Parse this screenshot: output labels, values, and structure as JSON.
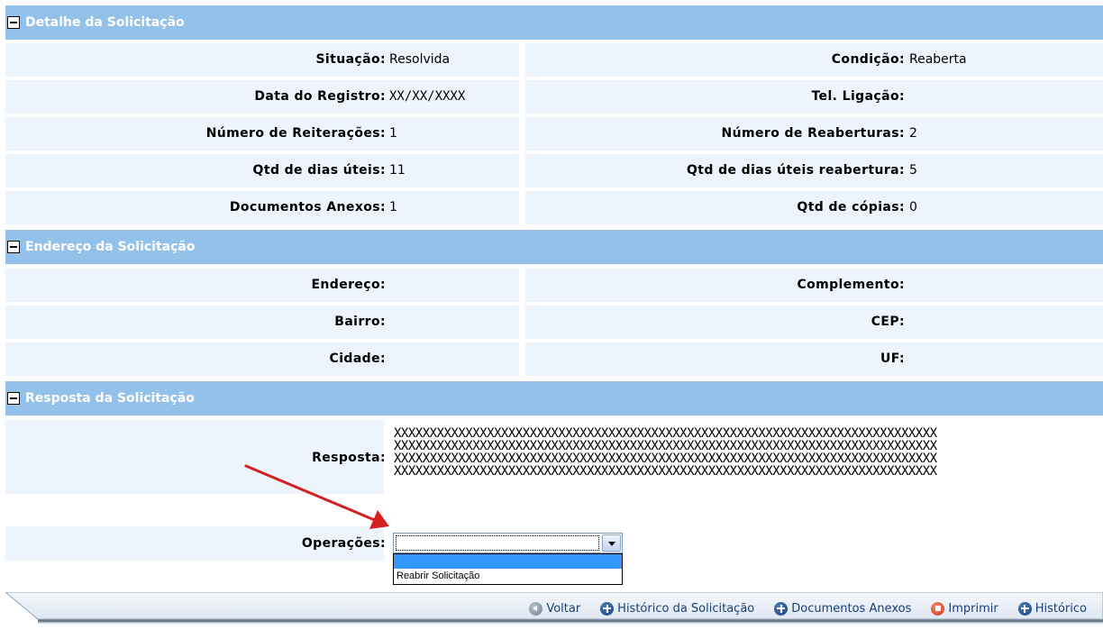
{
  "detalhe": {
    "title": "Detalhe da Solicitação",
    "situacao_label": "Situação:",
    "situacao_value": "Resolvida",
    "condicao_label": "Condição:",
    "condicao_value": "Reaberta",
    "data_registro_label": "Data do Registro:",
    "data_registro_value": "XX/XX/XXXX",
    "tel_ligacao_label": "Tel. Ligação:",
    "tel_ligacao_value": "",
    "num_reiteracoes_label": "Número de Reiterações:",
    "num_reiteracoes_value": "1",
    "num_reaberturas_label": "Número de Reaberturas:",
    "num_reaberturas_value": "2",
    "dias_uteis_label": "Qtd de dias úteis:",
    "dias_uteis_value": "11",
    "dias_uteis_reab_label": "Qtd de dias úteis reabertura:",
    "dias_uteis_reab_value": "5",
    "docs_anexos_label": "Documentos Anexos:",
    "docs_anexos_value": "1",
    "copias_label": "Qtd de cópias:",
    "copias_value": "0"
  },
  "endereco": {
    "title": "Endereço da Solicitação",
    "endereco_label": "Endereço:",
    "endereco_value": "",
    "complemento_label": "Complemento:",
    "complemento_value": "",
    "bairro_label": "Bairro:",
    "bairro_value": "",
    "cep_label": "CEP:",
    "cep_value": "",
    "cidade_label": "Cidade:",
    "cidade_value": "",
    "uf_label": "UF:",
    "uf_value": ""
  },
  "resposta": {
    "title": "Resposta da Solicitação",
    "resposta_label": "Resposta:",
    "lines": [
      "XXXXXXXXXXXXXXXXXXXXXXXXXXXXXXXXXXXXXXXXXXXXXXXXXXXXXXXXXXXXXXXXXXXXXXXXXXXX",
      "XXXXXXXXXXXXXXXXXXXXXXXXXXXXXXXXXXXXXXXXXXXXXXXXXXXXXXXXXXXXXXXXXXXXXXXXXXXX",
      "XXXXXXXXXXXXXXXXXXXXXXXXXXXXXXXXXXXXXXXXXXXXXXXXXXXXXXXXXXXXXXXXXXXXXXXXXXXX",
      "XXXXXXXXXXXXXXXXXXXXXXXXXXXXXXXXXXXXXXXXXXXXXXXXXXXXXXXXXXXXXXXXXXXXXXXXXXXX"
    ],
    "operacoes_label": "Operações:",
    "operacoes_selected": "",
    "operacoes_options": [
      "",
      "Reabrir Solicitação"
    ]
  },
  "toolbar": {
    "voltar": "Voltar",
    "historico_solicitacao": "Histórico da Solicitação",
    "documentos_anexos": "Documentos Anexos",
    "imprimir": "Imprimir",
    "historico": "Histórico"
  },
  "annotation": {
    "arrow_color": "#d42020"
  },
  "colors": {
    "header_bg": "#93c1ea",
    "row_bg": "#edf4fb",
    "link_color": "#1b3f7a"
  }
}
